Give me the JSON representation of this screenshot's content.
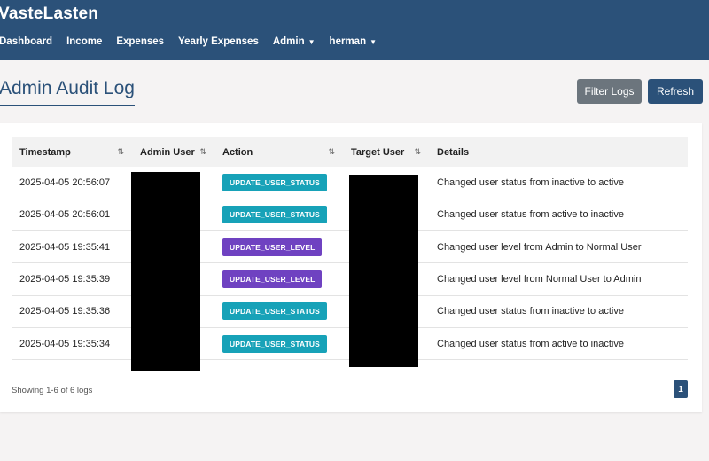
{
  "app": {
    "brand": "VasteLasten"
  },
  "nav": {
    "items": [
      {
        "label": "Dashboard"
      },
      {
        "label": "Income"
      },
      {
        "label": "Expenses"
      },
      {
        "label": "Yearly Expenses"
      },
      {
        "label": "Admin",
        "caret": "▼"
      },
      {
        "label": "herman",
        "caret": "▼"
      }
    ]
  },
  "page": {
    "title": "Admin Audit Log"
  },
  "buttons": {
    "filter": "Filter Logs",
    "refresh": "Refresh"
  },
  "table": {
    "columns": [
      "Timestamp",
      "Admin User",
      "Action",
      "Target User",
      "Details"
    ],
    "sort_icon": "⇅",
    "rows": [
      {
        "timestamp": "2025-04-05 20:56:07",
        "action": "UPDATE_USER_STATUS",
        "details": "Changed user status from inactive to active"
      },
      {
        "timestamp": "2025-04-05 20:56:01",
        "action": "UPDATE_USER_STATUS",
        "details": "Changed user status from active to inactive"
      },
      {
        "timestamp": "2025-04-05 19:35:41",
        "action": "UPDATE_USER_LEVEL",
        "details": "Changed user level from Admin to Normal User"
      },
      {
        "timestamp": "2025-04-05 19:35:39",
        "action": "UPDATE_USER_LEVEL",
        "details": "Changed user level from Normal User to Admin"
      },
      {
        "timestamp": "2025-04-05 19:35:36",
        "action": "UPDATE_USER_STATUS",
        "details": "Changed user status from inactive to active"
      },
      {
        "timestamp": "2025-04-05 19:35:34",
        "action": "UPDATE_USER_STATUS",
        "details": "Changed user status from active to inactive"
      }
    ]
  },
  "colors": {
    "navbar": "#2b5179",
    "badge_status": "#17a2b8",
    "badge_level": "#6f42c1",
    "filter_button": "#6c757d"
  },
  "pagination": {
    "summary": "Showing 1-6 of 6 logs",
    "current_page": "1"
  }
}
